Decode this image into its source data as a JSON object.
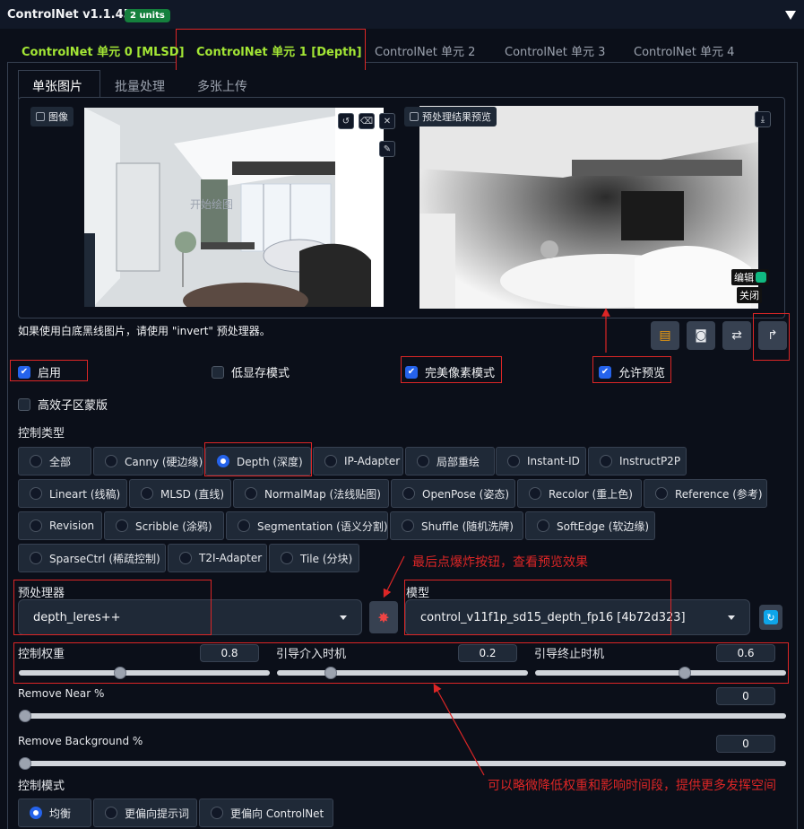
{
  "header": {
    "title": "ControlNet v1.1.455",
    "units_badge": "2 units"
  },
  "unit_tabs": [
    "ControlNet 单元 0 [MLSD]",
    "ControlNet 单元 1 [Depth]",
    "ControlNet 单元 2",
    "ControlNet 单元 3",
    "ControlNet 单元 4"
  ],
  "sub_tabs": [
    "单张图片",
    "批量处理",
    "多张上传"
  ],
  "image_panel": {
    "input_label": "图像",
    "preview_label": "预处理结果预览",
    "edit_badge": "编辑",
    "close_badge": "关闭",
    "watermark": "开始绘图"
  },
  "hint": "如果使用白底黑线图片，请使用 \"invert\" 预处理器。",
  "checkboxes": {
    "enable": "启用",
    "lowvram": "低显存模式",
    "pixel_perfect": "完美像素模式",
    "allow_preview": "允许预览",
    "efficient_mask": "高效子区蒙版"
  },
  "control_type": {
    "label": "控制类型",
    "options": [
      "全部",
      "Canny (硬边缘)",
      "Depth (深度)",
      "IP-Adapter",
      "局部重绘",
      "Instant-ID",
      "InstructP2P",
      "Lineart (线稿)",
      "MLSD (直线)",
      "NormalMap (法线贴图)",
      "OpenPose (姿态)",
      "Recolor (重上色)",
      "Reference (参考)",
      "Revision",
      "Scribble (涂鸦)",
      "Segmentation (语义分割)",
      "Shuffle (随机洗牌)",
      "SoftEdge (软边缘)",
      "SparseCtrl (稀疏控制)",
      "T2I-Adapter",
      "Tile (分块)"
    ],
    "selected": "Depth (深度)"
  },
  "preprocessor": {
    "label": "预处理器",
    "value": "depth_leres++"
  },
  "model": {
    "label": "模型",
    "value": "control_v11f1p_sd15_depth_fp16 [4b72d323]"
  },
  "sliders": {
    "weight": {
      "label": "控制权重",
      "value": "0.8",
      "level": 0.4
    },
    "start": {
      "label": "引导介入时机",
      "value": "0.2",
      "level": 0.2
    },
    "end": {
      "label": "引导终止时机",
      "value": "0.6",
      "level": 0.6
    },
    "remove_near": {
      "label": "Remove Near %",
      "value": "0",
      "level": 0
    },
    "remove_bg": {
      "label": "Remove Background %",
      "value": "0",
      "level": 0
    }
  },
  "control_mode": {
    "label": "控制模式",
    "options": [
      "均衡",
      "更偏向提示词",
      "更偏向 ControlNet"
    ],
    "selected": "均衡"
  },
  "annotations": {
    "note1": "最后点爆炸按钮，查看预览效果",
    "note2": "可以略微降低权重和影响时间段，提供更多发挥空间"
  },
  "colors": {
    "accent": "#2563eb",
    "annotation": "#dc2626",
    "active_tab": "#a3e635"
  }
}
